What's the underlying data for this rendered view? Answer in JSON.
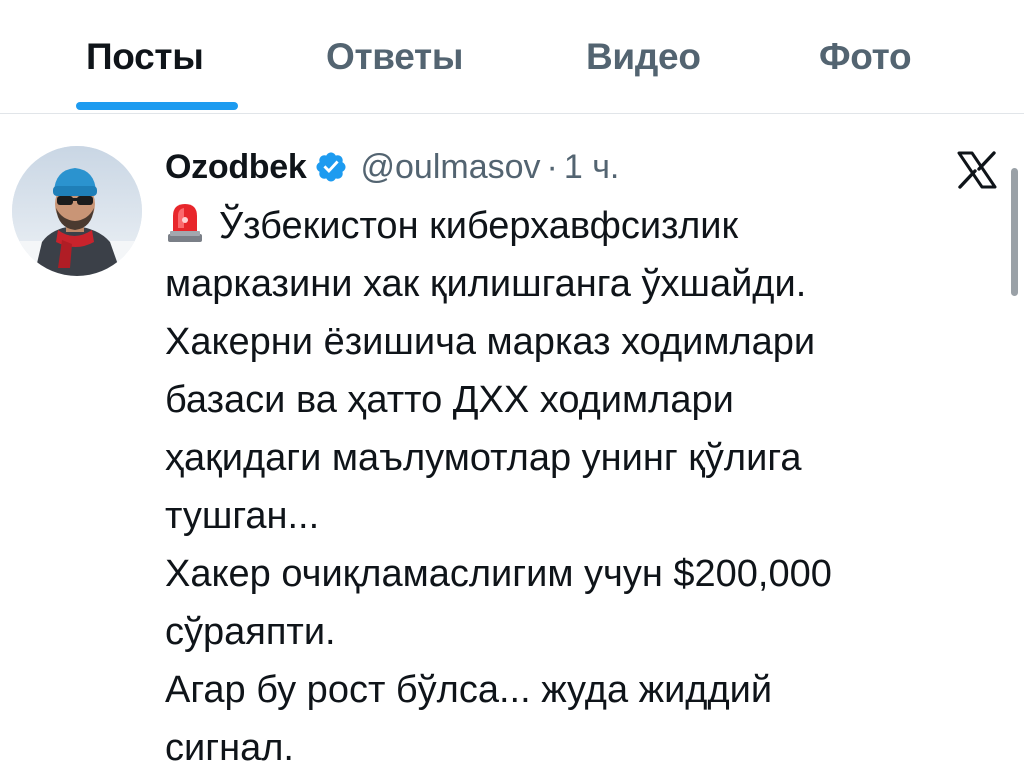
{
  "tabs": [
    {
      "label": "Посты",
      "active": true
    },
    {
      "label": "Ответы",
      "active": false
    },
    {
      "label": "Видео",
      "active": false
    },
    {
      "label": "Фото",
      "active": false
    }
  ],
  "tweet": {
    "author": {
      "display_name": "Ozodbek",
      "handle": "@oulmasov",
      "verified": true
    },
    "separator": "·",
    "time": "1 ч.",
    "platform_icon": "x-logo-icon",
    "lead_icon": "siren-icon",
    "lines": [
      "Ўзбекистон киберхавфсизлик",
      "марказини хак қилишганга ўхшайди.",
      "Хакерни ёзишича марказ ходимлари",
      "базаси ва ҳатто ДХХ ходимлари",
      "ҳақидаги маълумотлар унинг қўлига",
      "тушган...",
      "Хакер очиқламаслигим учун $200,000",
      "сўраяпти.",
      "Агар бу рост бўлса... жуда жиддий",
      "сигнал."
    ]
  },
  "colors": {
    "accent": "#1d9bf0",
    "text_primary": "#0f1419",
    "text_secondary": "#536471"
  }
}
